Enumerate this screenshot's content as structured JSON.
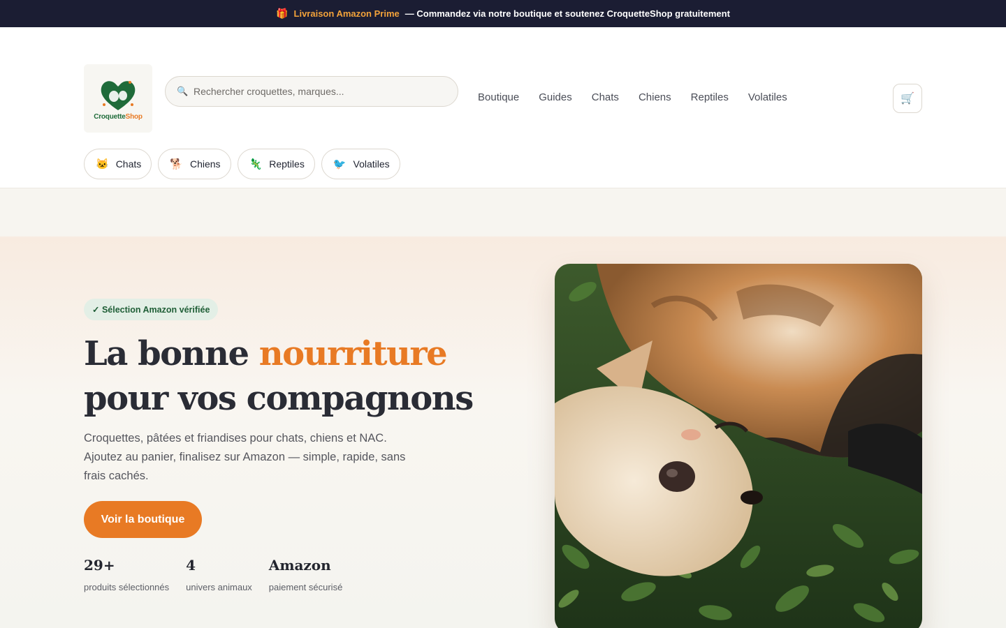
{
  "announcement": {
    "icon": "gift-icon",
    "highlight": "Livraison Amazon Prime",
    "text": "— Commandez via notre boutique et soutenez CroquetteShop gratuitement"
  },
  "header": {
    "logo": {
      "brand_part1": "Croquette",
      "brand_part2": "Shop"
    },
    "search": {
      "placeholder": "Rechercher croquettes, marques..."
    },
    "nav": [
      "Boutique",
      "Guides",
      "Chats",
      "Chiens",
      "Reptiles",
      "Volatiles"
    ],
    "cart_icon": "cart-icon"
  },
  "categories": [
    {
      "label": "Chats",
      "icon": "cat-icon"
    },
    {
      "label": "Chiens",
      "icon": "dog-icon"
    },
    {
      "label": "Reptiles",
      "icon": "lizard-icon"
    },
    {
      "label": "Volatiles",
      "icon": "bird-icon"
    }
  ],
  "hero": {
    "badge": "✓ Sélection Amazon vérifiée",
    "headline_part1": "La bonne ",
    "headline_accent": "nourriture",
    "headline_part2": "pour vos compagnons",
    "lead": "Croquettes, pâtées et friandises pour chats, chiens et NAC. Ajoutez au panier, finalisez sur Amazon — simple, rapide, sans frais cachés.",
    "cta": "Voir la boutique",
    "stats": [
      {
        "value": "29+",
        "label": "produits sélectionnés"
      },
      {
        "value": "4",
        "label": "univers animaux"
      },
      {
        "value": "Amazon",
        "label": "paiement sécurisé"
      }
    ]
  },
  "colors": {
    "topbar_bg": "#1b1d33",
    "accent": "#e87a24",
    "brand_green": "#1f6b3a",
    "badge_bg": "#e3efe6"
  }
}
